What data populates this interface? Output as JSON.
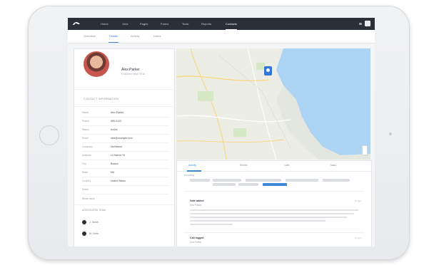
{
  "topnav": {
    "items": [
      {
        "label": "Home"
      },
      {
        "label": "Jobs"
      },
      {
        "label": "Pages"
      },
      {
        "label": "Forms"
      },
      {
        "label": "Tools"
      },
      {
        "label": "Reports"
      },
      {
        "label": "Contacts",
        "active": true
      }
    ]
  },
  "subnav": {
    "tabs": [
      {
        "label": "Overview"
      },
      {
        "label": "Details",
        "active": true
      },
      {
        "label": "Activity"
      },
      {
        "label": "Notes"
      }
    ]
  },
  "profile": {
    "name": "Alex Parker",
    "subtitle": "Customer since 2016",
    "section_title": "CONTACT INFORMATION",
    "fields": [
      {
        "key": "Name",
        "value": "Alex Parker"
      },
      {
        "key": "Phone",
        "value": "555-0123"
      },
      {
        "key": "Status",
        "value": "Active"
      },
      {
        "key": "Email",
        "value": "alex@example.com"
      },
      {
        "key": "Company",
        "value": "Northwind"
      },
      {
        "key": "Address",
        "value": "12 Harbor St"
      },
      {
        "key": "City",
        "value": "Boston"
      },
      {
        "key": "State",
        "value": "MA"
      },
      {
        "key": "Country",
        "value": "United States"
      },
      {
        "key": "Notes",
        "value": ""
      }
    ],
    "more_link": "Show more",
    "related_title": "ASSOCIATED TEAM",
    "related_items": [
      {
        "label": "J. Smith"
      },
      {
        "label": "M. Chen"
      }
    ]
  },
  "activity": {
    "tabs": [
      {
        "label": "Activity",
        "active": true
      },
      {
        "label": "Emails"
      },
      {
        "label": "Calls"
      },
      {
        "label": "Tasks"
      }
    ],
    "crumb": "All activity",
    "items": [
      {
        "title": "Note added",
        "subtitle": "Alex Parker",
        "time": "2h ago"
      },
      {
        "title": "Call logged",
        "subtitle": "Alex Parker",
        "time": "1d ago"
      }
    ]
  }
}
